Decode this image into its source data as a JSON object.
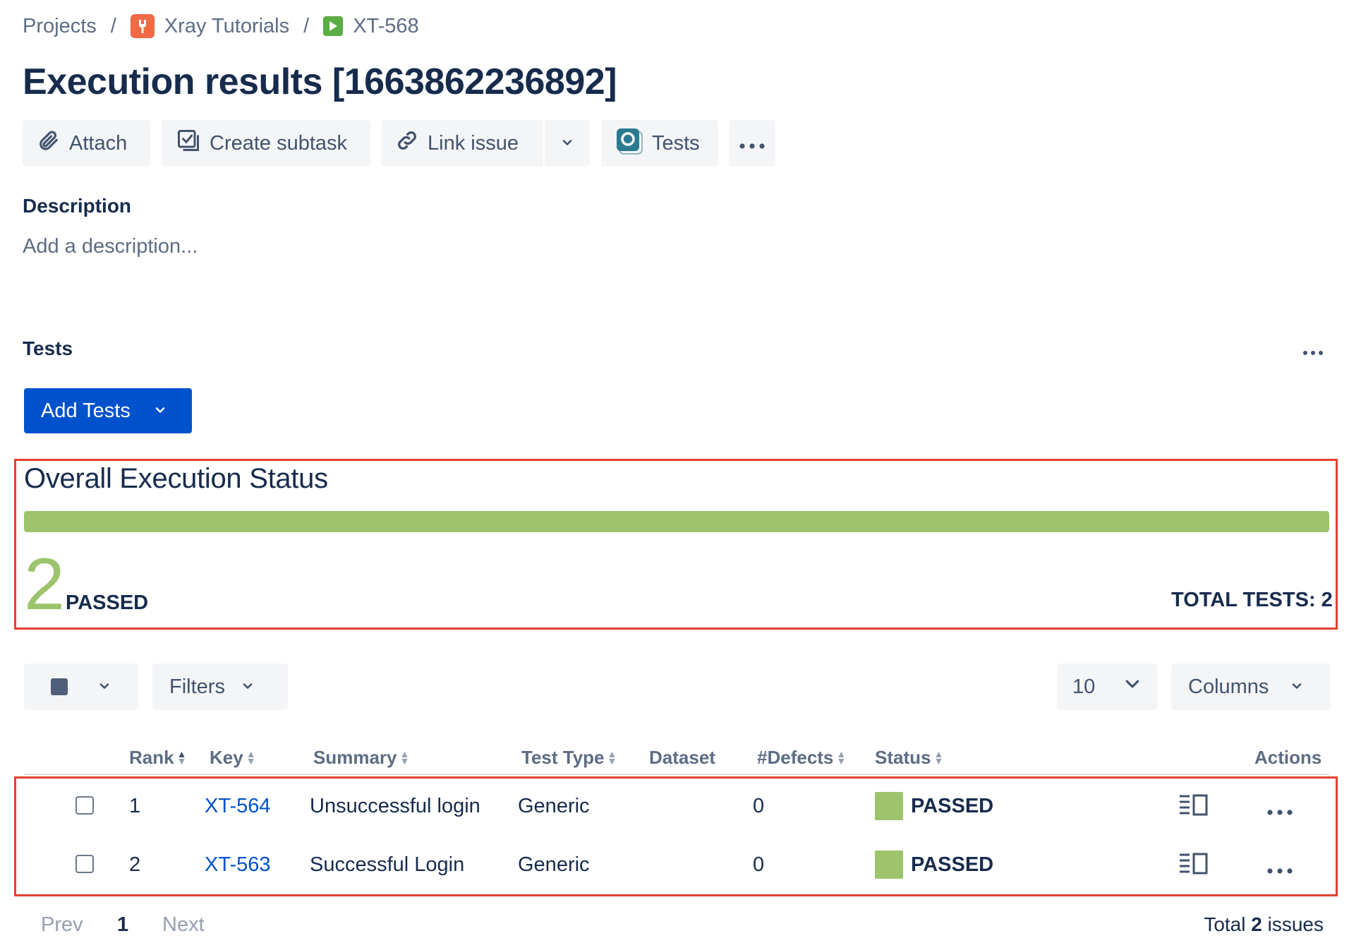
{
  "breadcrumb": {
    "projects": "Projects",
    "separator": "/",
    "project_name": "Xray Tutorials",
    "issue_key": "XT-568"
  },
  "page_title": "Execution results [1663862236892]",
  "toolbar": {
    "attach": "Attach",
    "create_subtask": "Create subtask",
    "link_issue": "Link issue",
    "tests": "Tests"
  },
  "description": {
    "heading": "Description",
    "placeholder": "Add a description..."
  },
  "tests_section": {
    "heading": "Tests",
    "add_tests": "Add Tests"
  },
  "overall_status": {
    "title": "Overall Execution Status",
    "passed_count": "2",
    "passed_label": "PASSED",
    "total_label": "TOTAL TESTS: 2",
    "progress_fraction": 1.0,
    "passed_color": "#9dc46c"
  },
  "controls": {
    "filters": "Filters",
    "page_size": "10",
    "columns": "Columns"
  },
  "table": {
    "headers": {
      "rank": "Rank",
      "key": "Key",
      "summary": "Summary",
      "test_type": "Test Type",
      "dataset": "Dataset",
      "defects": "#Defects",
      "status": "Status",
      "actions": "Actions"
    },
    "rows": [
      {
        "rank": "1",
        "key": "XT-564",
        "summary": "Unsuccessful login",
        "test_type": "Generic",
        "defects": "0",
        "status": "PASSED"
      },
      {
        "rank": "2",
        "key": "XT-563",
        "summary": "Successful Login",
        "test_type": "Generic",
        "defects": "0",
        "status": "PASSED"
      }
    ]
  },
  "pagination": {
    "prev": "Prev",
    "current": "1",
    "next": "Next",
    "total_prefix": "Total",
    "total_count": "2",
    "total_suffix": "issues"
  },
  "colors": {
    "primary_button": "#0052cc",
    "highlight_border": "#e2422f",
    "link": "#0052cc"
  },
  "icons": [
    "xray-project-icon",
    "test-execution-icon",
    "paperclip-icon",
    "subtask-icon",
    "link-icon",
    "chevron-down-icon",
    "xray-tests-icon",
    "more-icon",
    "sort-icon",
    "details-icon"
  ]
}
